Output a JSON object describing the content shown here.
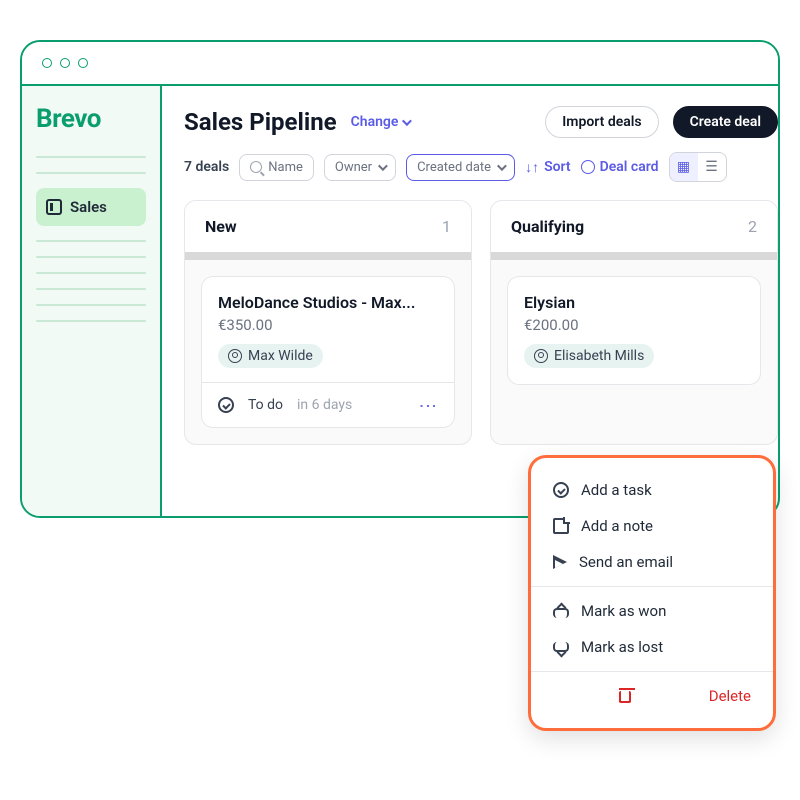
{
  "logo": "Brevo",
  "sidebar": {
    "active": "Sales"
  },
  "header": {
    "title": "Sales Pipeline",
    "change": "Change",
    "import": "Import deals",
    "create": "Create deal"
  },
  "toolbar": {
    "count": "7 deals",
    "name_placeholder": "Name",
    "owner": "Owner",
    "created": "Created date",
    "sort": "Sort",
    "dealcard": "Deal card"
  },
  "columns": [
    {
      "title": "New",
      "count": "1",
      "card": {
        "title": "MeloDance Studios - Max...",
        "price": "€350.00",
        "owner": "Max Wilde",
        "task": "To do",
        "due": "in 6 days"
      }
    },
    {
      "title": "Qualifying",
      "count": "2",
      "card": {
        "title": "Elysian",
        "price": "€200.00",
        "owner": "Elisabeth Mills"
      }
    }
  ],
  "menu": {
    "task": "Add a task",
    "note": "Add a note",
    "email": "Send an email",
    "won": "Mark as won",
    "lost": "Mark as lost",
    "delete": "Delete"
  }
}
